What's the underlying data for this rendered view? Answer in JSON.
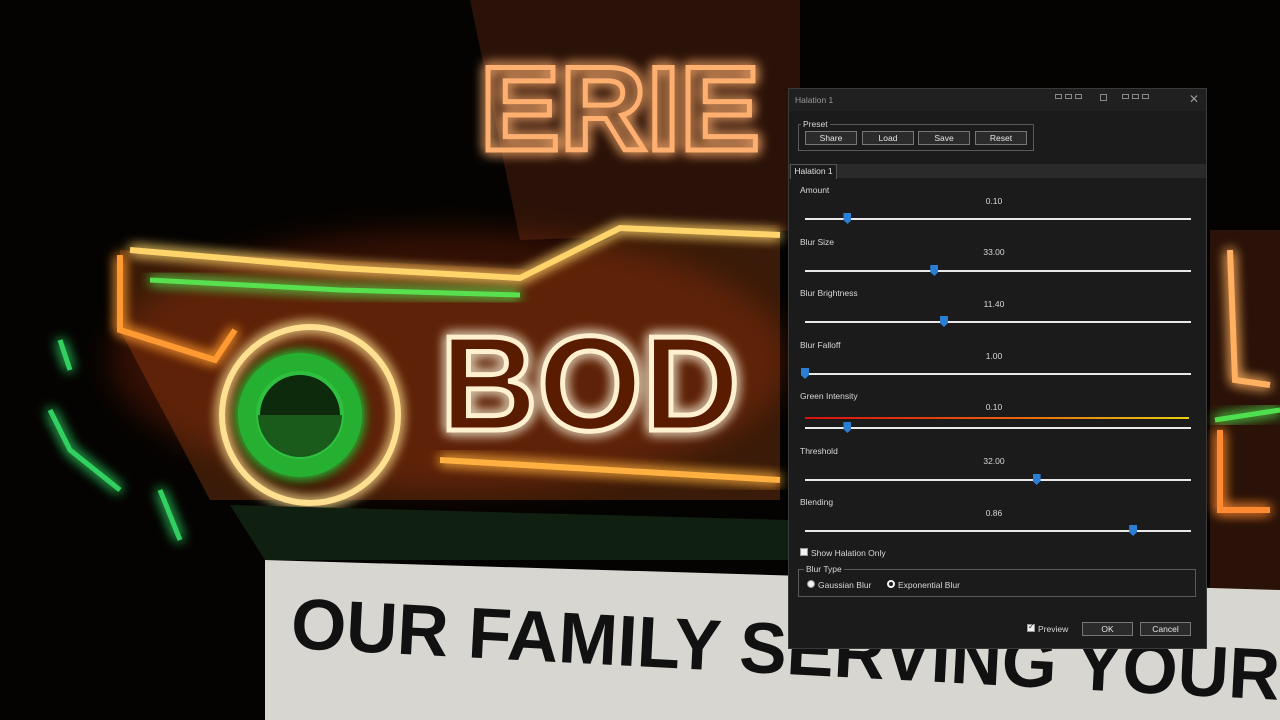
{
  "background": {
    "sign_top": "ERIE",
    "sign_mid": "BOD",
    "marquee_line": "OUR FAMILY SERVING YOUR"
  },
  "dialog": {
    "title": "Halation 1",
    "preset": {
      "legend": "Preset",
      "buttons": [
        "Share",
        "Load",
        "Save",
        "Reset"
      ]
    },
    "tab": "Halation 1",
    "sliders": [
      {
        "label": "Amount",
        "value": "0.10",
        "fraction": 0.11
      },
      {
        "label": "Blur Size",
        "value": "33.00",
        "fraction": 0.335
      },
      {
        "label": "Blur Brightness",
        "value": "11.40",
        "fraction": 0.36
      },
      {
        "label": "Blur Falloff",
        "value": "1.00",
        "fraction": 0.0
      },
      {
        "label": "Green Intensity",
        "value": "0.10",
        "fraction": 0.11
      },
      {
        "label": "Threshold",
        "value": "32.00",
        "fraction": 0.6
      },
      {
        "label": "Blending",
        "value": "0.86",
        "fraction": 0.85
      }
    ],
    "show_halation_only": {
      "label": "Show Halation Only",
      "checked": false
    },
    "blur_type": {
      "legend": "Blur Type",
      "options": [
        {
          "label": "Gaussian Blur",
          "selected": false
        },
        {
          "label": "Exponential Blur",
          "selected": true
        }
      ]
    },
    "preview": {
      "label": "Preview",
      "checked": true
    },
    "ok_label": "OK",
    "cancel_label": "Cancel"
  }
}
